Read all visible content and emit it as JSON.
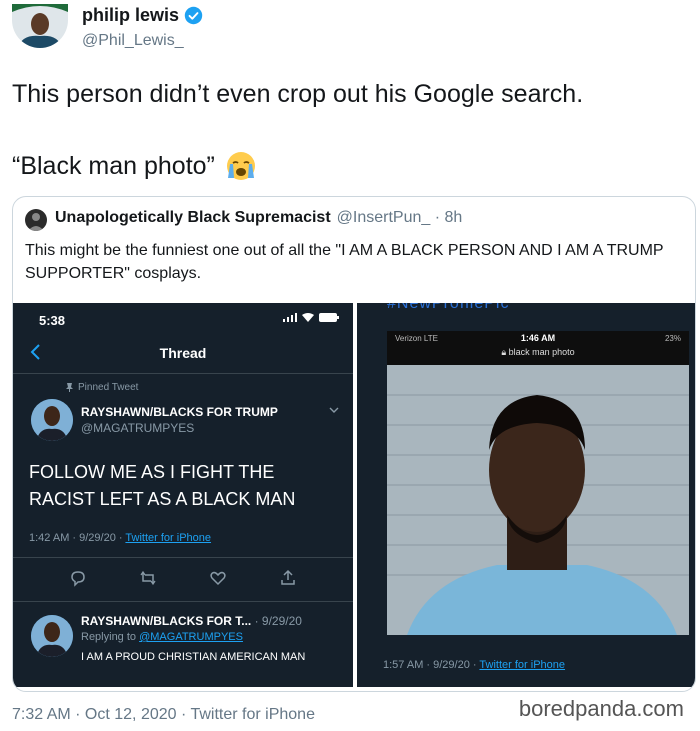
{
  "author": {
    "name": "philip lewis",
    "handle": "@Phil_Lewis_"
  },
  "tweet": {
    "line1": "This person didn’t even crop out his Google search.",
    "line2": "“Black man photo”",
    "emoji": "loudly-crying-face",
    "footer": "7:32 AM · Oct 12, 2020 · Twitter for iPhone"
  },
  "quote": {
    "name": "Unapologetically Black Supremacist",
    "handle": "@InsertPun_ · 8h",
    "text": "This might be the funniest one out of all the \"I AM A BLACK PERSON AND I AM A TRUMP SUPPORTER\" cosplays."
  },
  "left_screenshot": {
    "status_time": "5:38",
    "title": "Thread",
    "pinned": "Pinned Tweet",
    "name": "RAYSHAWN/BLACKS FOR TRUMP",
    "handle": "@MAGATRUMPYES",
    "text": "FOLLOW ME AS I FIGHT THE RACIST LEFT AS A BLACK MAN",
    "meta": "1:42 AM · 9/29/20 · ",
    "meta_link": "Twitter for iPhone",
    "reply_name": "RAYSHAWN/BLACKS FOR T...",
    "reply_date": "· 9/29/20",
    "replying_to": "Replying to ",
    "replying_handle": "@MAGATRUMPYES",
    "reply_text": "I AM A PROUD CHRISTIAN AMERICAN MAN"
  },
  "right_screenshot": {
    "hashtag": "#NewProfilePic",
    "carrier": "Verizon LTE",
    "time": "1:46 AM",
    "battery": "23%",
    "search": "black man photo",
    "meta": "1:57 AM · 9/29/20 · ",
    "meta_link": "Twitter for iPhone"
  },
  "watermark": "boredpanda.com",
  "colors": {
    "link": "#1da1f2",
    "verified": "#1da1f2",
    "dark_bg": "#15202b"
  }
}
